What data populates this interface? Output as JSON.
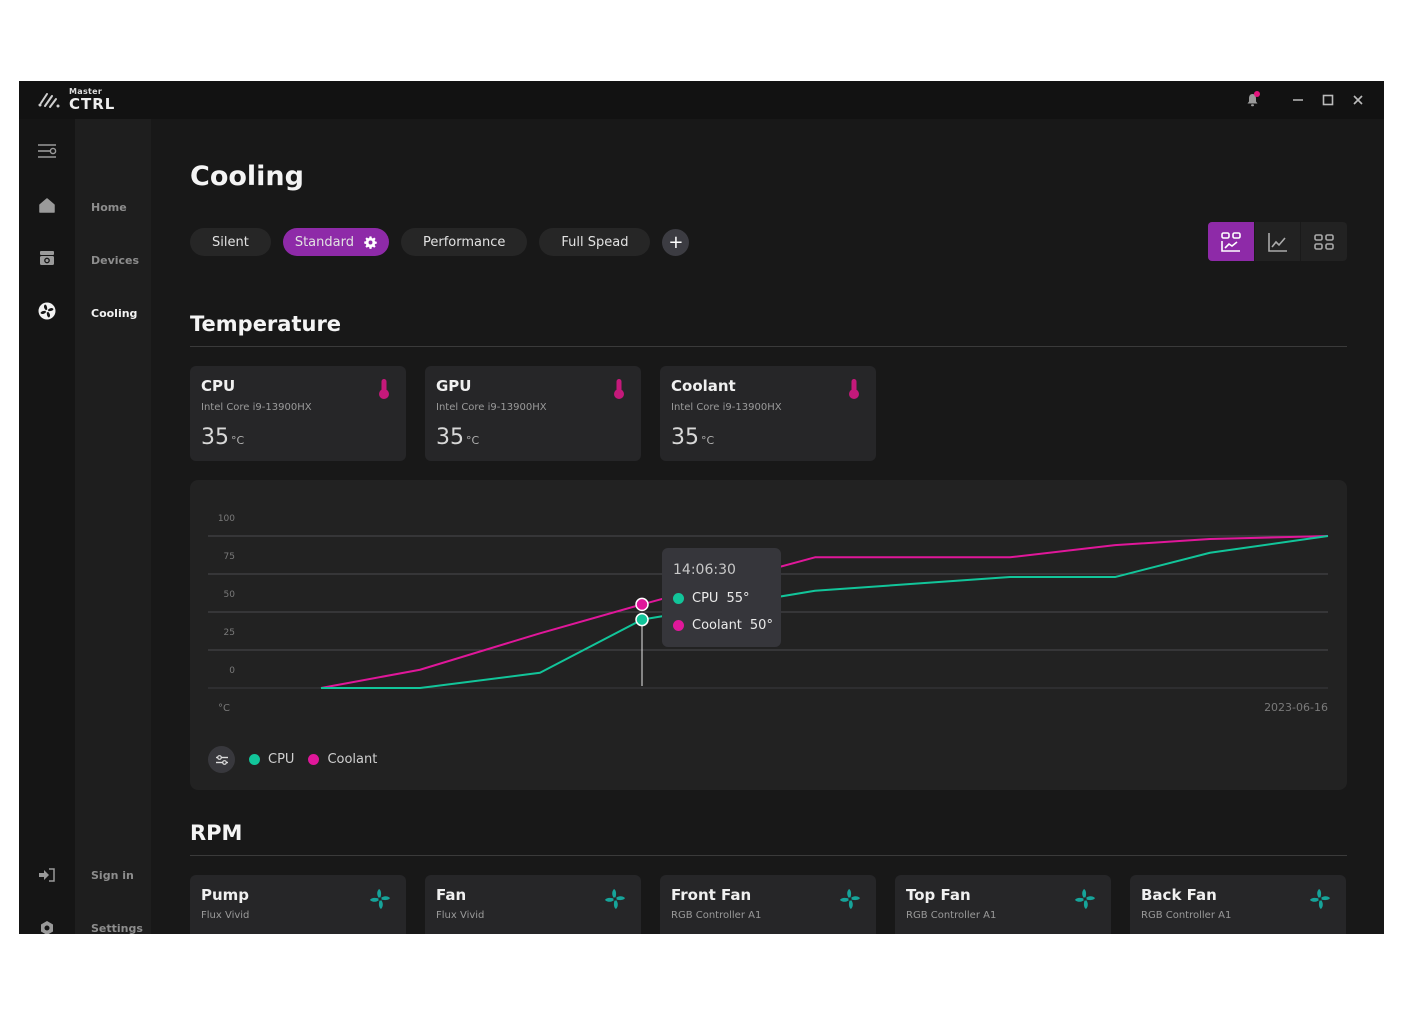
{
  "app": {
    "logo_small": "Master",
    "logo_big": "CTRL",
    "notification_icon": "bell-icon",
    "window_controls": [
      "minimize",
      "maximize",
      "close"
    ]
  },
  "sidebar": {
    "items": [
      {
        "label": "Home",
        "icon": "home-icon",
        "active": false
      },
      {
        "label": "Devices",
        "icon": "device-icon",
        "active": false
      },
      {
        "label": "Cooling",
        "icon": "fan-icon",
        "active": true
      }
    ],
    "bottom_items": [
      {
        "label": "Sign in",
        "icon": "sign-in-icon"
      },
      {
        "label": "Settings",
        "icon": "settings-icon"
      }
    ]
  },
  "page": {
    "title": "Cooling",
    "profiles": [
      {
        "label": "Silent",
        "active": false
      },
      {
        "label": "Standard",
        "active": true
      },
      {
        "label": "Performance",
        "active": false
      },
      {
        "label": "Full Spead",
        "active": false
      }
    ],
    "add_profile_label": "+",
    "view_modes": [
      {
        "name": "dashboard-view",
        "active": true
      },
      {
        "name": "chart-view",
        "active": false
      },
      {
        "name": "grid-view",
        "active": false
      }
    ],
    "accent": "#8e2aa8"
  },
  "temperature": {
    "title": "Temperature",
    "cards": [
      {
        "title": "CPU",
        "subtitle": "Intel Core i9-13900HX",
        "value": "35",
        "unit": "°C"
      },
      {
        "title": "GPU",
        "subtitle": "Intel Core i9-13900HX",
        "value": "35",
        "unit": "°C"
      },
      {
        "title": "Coolant",
        "subtitle": "Intel Core i9-13900HX",
        "value": "35",
        "unit": "°C"
      }
    ],
    "icon_color": "#c4197a"
  },
  "chart_data": {
    "type": "line",
    "title": "",
    "xlabel": "2023-06-16",
    "ylabel": "°C",
    "ylim": [
      0,
      100
    ],
    "yticks": [
      100,
      75,
      50,
      25,
      0
    ],
    "grid": true,
    "legend_position": "bottom-left",
    "x": [
      0,
      1,
      2,
      3,
      4,
      5,
      6,
      7,
      8
    ],
    "series": [
      {
        "name": "CPU",
        "color": "#12c59a",
        "values": [
          0,
          0,
          10,
          45,
          64,
          73,
          73,
          89,
          100
        ]
      },
      {
        "name": "Coolant",
        "color": "#e0179a",
        "values": [
          0,
          12,
          36,
          55,
          86,
          86,
          94,
          98,
          100
        ]
      }
    ],
    "tooltip": {
      "time": "14:06:30",
      "index": 3,
      "rows": [
        {
          "name": "CPU",
          "value": "55°"
        },
        {
          "name": "Coolant",
          "value": "50°"
        }
      ]
    }
  },
  "rpm": {
    "title": "RPM",
    "cards": [
      {
        "title": "Pump",
        "subtitle": "Flux Vivid"
      },
      {
        "title": "Fan",
        "subtitle": "Flux Vivid"
      },
      {
        "title": "Front Fan",
        "subtitle": "RGB Controller A1"
      },
      {
        "title": "Top Fan",
        "subtitle": "RGB Controller A1"
      },
      {
        "title": "Back Fan",
        "subtitle": "RGB Controller A1"
      }
    ],
    "icon_color": "#16a49a"
  }
}
